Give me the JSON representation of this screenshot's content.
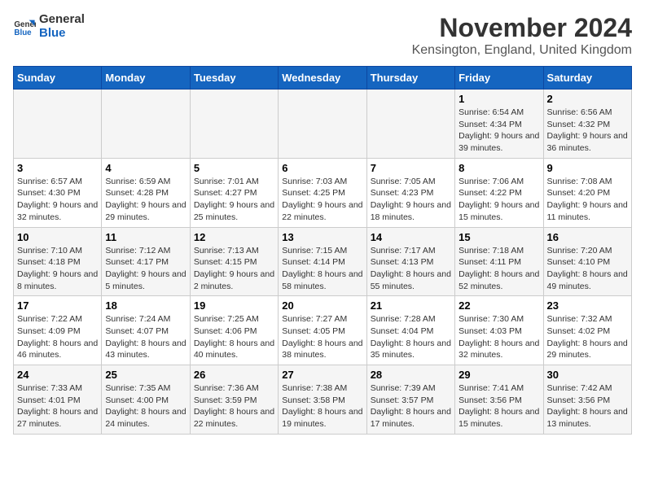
{
  "logo": {
    "line1": "General",
    "line2": "Blue"
  },
  "title": "November 2024",
  "location": "Kensington, England, United Kingdom",
  "days_of_week": [
    "Sunday",
    "Monday",
    "Tuesday",
    "Wednesday",
    "Thursday",
    "Friday",
    "Saturday"
  ],
  "weeks": [
    [
      {
        "day": "",
        "info": ""
      },
      {
        "day": "",
        "info": ""
      },
      {
        "day": "",
        "info": ""
      },
      {
        "day": "",
        "info": ""
      },
      {
        "day": "",
        "info": ""
      },
      {
        "day": "1",
        "info": "Sunrise: 6:54 AM\nSunset: 4:34 PM\nDaylight: 9 hours and 39 minutes."
      },
      {
        "day": "2",
        "info": "Sunrise: 6:56 AM\nSunset: 4:32 PM\nDaylight: 9 hours and 36 minutes."
      }
    ],
    [
      {
        "day": "3",
        "info": "Sunrise: 6:57 AM\nSunset: 4:30 PM\nDaylight: 9 hours and 32 minutes."
      },
      {
        "day": "4",
        "info": "Sunrise: 6:59 AM\nSunset: 4:28 PM\nDaylight: 9 hours and 29 minutes."
      },
      {
        "day": "5",
        "info": "Sunrise: 7:01 AM\nSunset: 4:27 PM\nDaylight: 9 hours and 25 minutes."
      },
      {
        "day": "6",
        "info": "Sunrise: 7:03 AM\nSunset: 4:25 PM\nDaylight: 9 hours and 22 minutes."
      },
      {
        "day": "7",
        "info": "Sunrise: 7:05 AM\nSunset: 4:23 PM\nDaylight: 9 hours and 18 minutes."
      },
      {
        "day": "8",
        "info": "Sunrise: 7:06 AM\nSunset: 4:22 PM\nDaylight: 9 hours and 15 minutes."
      },
      {
        "day": "9",
        "info": "Sunrise: 7:08 AM\nSunset: 4:20 PM\nDaylight: 9 hours and 11 minutes."
      }
    ],
    [
      {
        "day": "10",
        "info": "Sunrise: 7:10 AM\nSunset: 4:18 PM\nDaylight: 9 hours and 8 minutes."
      },
      {
        "day": "11",
        "info": "Sunrise: 7:12 AM\nSunset: 4:17 PM\nDaylight: 9 hours and 5 minutes."
      },
      {
        "day": "12",
        "info": "Sunrise: 7:13 AM\nSunset: 4:15 PM\nDaylight: 9 hours and 2 minutes."
      },
      {
        "day": "13",
        "info": "Sunrise: 7:15 AM\nSunset: 4:14 PM\nDaylight: 8 hours and 58 minutes."
      },
      {
        "day": "14",
        "info": "Sunrise: 7:17 AM\nSunset: 4:13 PM\nDaylight: 8 hours and 55 minutes."
      },
      {
        "day": "15",
        "info": "Sunrise: 7:18 AM\nSunset: 4:11 PM\nDaylight: 8 hours and 52 minutes."
      },
      {
        "day": "16",
        "info": "Sunrise: 7:20 AM\nSunset: 4:10 PM\nDaylight: 8 hours and 49 minutes."
      }
    ],
    [
      {
        "day": "17",
        "info": "Sunrise: 7:22 AM\nSunset: 4:09 PM\nDaylight: 8 hours and 46 minutes."
      },
      {
        "day": "18",
        "info": "Sunrise: 7:24 AM\nSunset: 4:07 PM\nDaylight: 8 hours and 43 minutes."
      },
      {
        "day": "19",
        "info": "Sunrise: 7:25 AM\nSunset: 4:06 PM\nDaylight: 8 hours and 40 minutes."
      },
      {
        "day": "20",
        "info": "Sunrise: 7:27 AM\nSunset: 4:05 PM\nDaylight: 8 hours and 38 minutes."
      },
      {
        "day": "21",
        "info": "Sunrise: 7:28 AM\nSunset: 4:04 PM\nDaylight: 8 hours and 35 minutes."
      },
      {
        "day": "22",
        "info": "Sunrise: 7:30 AM\nSunset: 4:03 PM\nDaylight: 8 hours and 32 minutes."
      },
      {
        "day": "23",
        "info": "Sunrise: 7:32 AM\nSunset: 4:02 PM\nDaylight: 8 hours and 29 minutes."
      }
    ],
    [
      {
        "day": "24",
        "info": "Sunrise: 7:33 AM\nSunset: 4:01 PM\nDaylight: 8 hours and 27 minutes."
      },
      {
        "day": "25",
        "info": "Sunrise: 7:35 AM\nSunset: 4:00 PM\nDaylight: 8 hours and 24 minutes."
      },
      {
        "day": "26",
        "info": "Sunrise: 7:36 AM\nSunset: 3:59 PM\nDaylight: 8 hours and 22 minutes."
      },
      {
        "day": "27",
        "info": "Sunrise: 7:38 AM\nSunset: 3:58 PM\nDaylight: 8 hours and 19 minutes."
      },
      {
        "day": "28",
        "info": "Sunrise: 7:39 AM\nSunset: 3:57 PM\nDaylight: 8 hours and 17 minutes."
      },
      {
        "day": "29",
        "info": "Sunrise: 7:41 AM\nSunset: 3:56 PM\nDaylight: 8 hours and 15 minutes."
      },
      {
        "day": "30",
        "info": "Sunrise: 7:42 AM\nSunset: 3:56 PM\nDaylight: 8 hours and 13 minutes."
      }
    ]
  ]
}
